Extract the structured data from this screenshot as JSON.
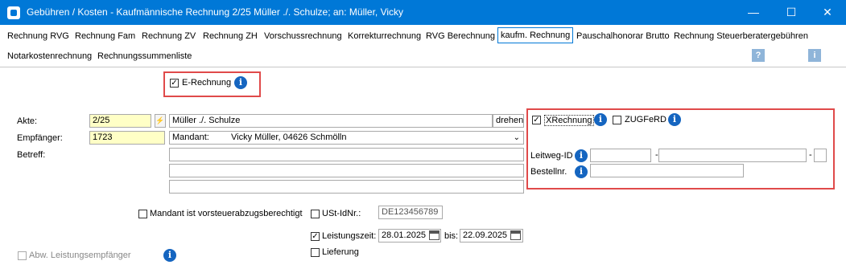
{
  "window": {
    "title": "Gebühren / Kosten - Kaufmännische Rechnung 2/25 Müller ./. Schulze; an: Müller, Vicky",
    "minimize": "—",
    "maximize": "☐",
    "close": "✕"
  },
  "tabs": [
    {
      "label": "Rechnung RVG"
    },
    {
      "label": "Rechnung Fam"
    },
    {
      "label": "Rechnung ZV"
    },
    {
      "label": "Rechnung ZH"
    },
    {
      "label": "Vorschussrechnung"
    },
    {
      "label": "Korrekturrechnung"
    },
    {
      "label": "RVG Berechnung"
    },
    {
      "label": "kaufm. Rechnung"
    },
    {
      "label": "Pauschalhonorar Brutto"
    },
    {
      "label": "Rechnung Steuerberatergebühren"
    },
    {
      "label": "Notarkostenrechnung"
    },
    {
      "label": "Rechnungssummenliste"
    }
  ],
  "toolbar": {
    "help": "?",
    "info": "i"
  },
  "form": {
    "e_rechnung_label": "E-Rechnung",
    "akte_label": "Akte:",
    "akte_value": "2/25",
    "akte_name": "Müller ./. Schulze",
    "drehen_label": "drehen",
    "empfaenger_label": "Empfänger:",
    "empfaenger_value": "1723",
    "mandant_prefix": "Mandant:",
    "mandant_value": "Vicky Müller, 04626 Schmölln",
    "betreff_label": "Betreff:",
    "vorsteuer_label": "Mandant ist vorsteuerabzugsberechtigt",
    "ustid_label": "USt-IdNr.:",
    "ustid_value": "DE123456789",
    "leistungszeit_label": "Leistungszeit:",
    "leistung_from": "28.01.2025",
    "bis_label": "bis:",
    "leistung_to": "22.09.2025",
    "lieferung_label": "Lieferung",
    "abw_label": "Abw. Leistungsempfänger",
    "xrechnung_label": "XRechnung",
    "zugferd_label": "ZUGFeRD",
    "leitweg_label": "Leitweg-ID",
    "bestellnr_label": "Bestellnr.",
    "dash": "-",
    "info_glyph": "i",
    "check_glyph": "✓"
  }
}
